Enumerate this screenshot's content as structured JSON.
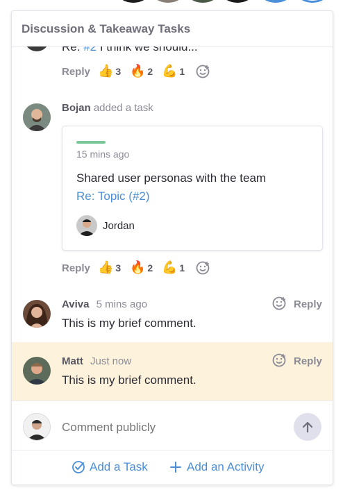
{
  "panel": {
    "title": "Discussion & Takeaway Tasks"
  },
  "truncated_comment": {
    "text_prefix": "Re: ",
    "ref": "#2",
    "text_rest": " I think we should..."
  },
  "reply_label": "Reply",
  "reaction_rows": [
    {
      "reactions": [
        {
          "emoji": "👍",
          "count": "3"
        },
        {
          "emoji": "🔥",
          "count": "2"
        },
        {
          "emoji": "💪",
          "count": "1"
        }
      ]
    },
    {
      "reactions": [
        {
          "emoji": "👍",
          "count": "3"
        },
        {
          "emoji": "🔥",
          "count": "2"
        },
        {
          "emoji": "💪",
          "count": "1"
        }
      ]
    }
  ],
  "task_event": {
    "author": "Bojan",
    "action": "added a task",
    "card": {
      "time": "15 mins ago",
      "title": "Shared user personas with the team",
      "link": "Re: Topic (#2)",
      "assignee": "Jordan",
      "accent_color": "#7cc79a"
    }
  },
  "comments": [
    {
      "author": "Aviva",
      "time": "5 mins ago",
      "text": "This is my brief comment."
    },
    {
      "author": "Matt",
      "time": "Just now",
      "text": "This is my brief comment."
    }
  ],
  "composer": {
    "placeholder": "Comment publicly"
  },
  "footer": {
    "add_task": "Add a Task",
    "add_activity": "Add an Activity"
  },
  "colors": {
    "link": "#4a8fd8",
    "highlight": "#fdf3dd",
    "send_button": "#e0e0ec"
  }
}
